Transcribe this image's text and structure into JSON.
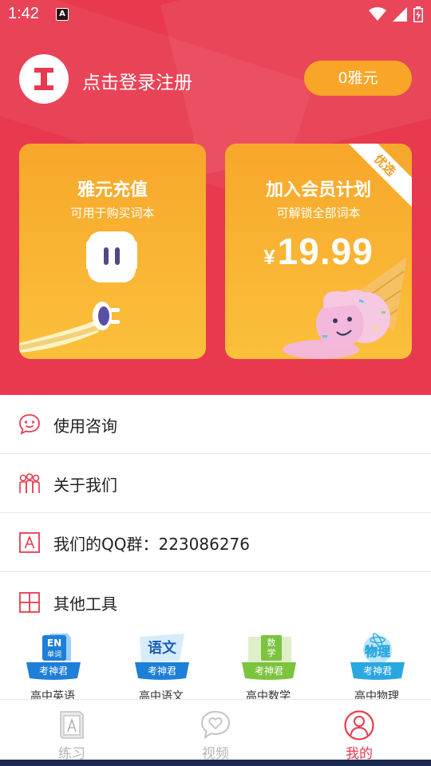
{
  "status_bar": {
    "time": "1:42",
    "notification_glyph": "A"
  },
  "profile": {
    "avatar_letter": "I",
    "login_text": "点击登录注册",
    "coin_button": "0雅元"
  },
  "cards": {
    "recharge": {
      "title": "雅元充值",
      "subtitle": "可用于购买词本"
    },
    "membership": {
      "title": "加入会员计划",
      "subtitle": "可解锁全部词本",
      "currency": "¥",
      "price": "19.99",
      "ribbon": "优选"
    }
  },
  "menu": {
    "consult": "使用咨询",
    "about": "关于我们",
    "qq_group": "我们的QQ群：223086276",
    "other_tools": "其他工具"
  },
  "tools": [
    {
      "name": "高中英语",
      "badge": "EN",
      "badge_sub": "单词",
      "brand": "考神君",
      "color": "#1e7fd8"
    },
    {
      "name": "高中语文",
      "badge": "语文",
      "badge_sub": "",
      "brand": "考神君",
      "color": "#1e7fd8"
    },
    {
      "name": "高中数学",
      "badge": "数",
      "badge_sub": "学",
      "brand": "考神君",
      "color": "#7cc33e"
    },
    {
      "name": "高中物理",
      "badge": "物理",
      "badge_sub": "",
      "brand": "考神君",
      "color": "#29a8e0"
    }
  ],
  "tabbar": {
    "practice": "练习",
    "video": "视频",
    "mine": "我的"
  },
  "colors": {
    "brand_red": "#e8394e",
    "accent_orange": "#f9a527",
    "inactive_gray": "#b5b5b5"
  }
}
